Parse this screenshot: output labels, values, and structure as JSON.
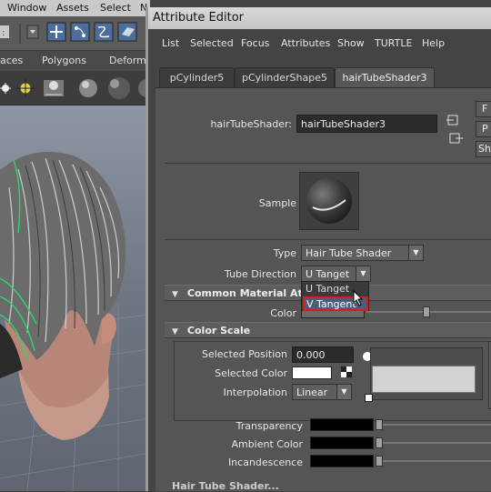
{
  "bg_menubar": [
    "Window",
    "Assets",
    "Select",
    "N"
  ],
  "bg_shelftabs": [
    "aces",
    "Polygons",
    "Deforma"
  ],
  "attribute_editor": {
    "title": "Attribute Editor",
    "menu": [
      "List",
      "Selected",
      "Focus",
      "Attributes",
      "Show",
      "TURTLE",
      "Help"
    ],
    "tabs": [
      "pCylinder5",
      "pCylinderShape5",
      "hairTubeShader3"
    ],
    "active_tab": "hairTubeShader3",
    "node_label": "hairTubeShader:",
    "node_name": "hairTubeShader3",
    "side_buttons": [
      "F",
      "P",
      "Sho"
    ],
    "sample_label": "Sample",
    "type_label": "Type",
    "type_value": "Hair Tube Shader",
    "tube_direction_label": "Tube Direction",
    "tube_direction_value": "U Tanget",
    "tube_direction_options": [
      "U Tanget",
      "V Tangent"
    ],
    "highlighted_option": "V Tangent",
    "section_common": "Common Material At",
    "color_label": "Color",
    "section_colorscale": "Color Scale",
    "selected_position_label": "Selected Position",
    "selected_position_value": "0.000",
    "selected_color_label": "Selected Color",
    "interpolation_label": "Interpolation",
    "interpolation_value": "Linear",
    "transparency_label": "Transparency",
    "ambient_label": "Ambient Color",
    "incandescence_label": "Incandescence",
    "bottom_section_partial": "Hair Tube Shader..."
  },
  "colors": {
    "highlight_box": "#e0191d",
    "hair_guides": "#2bd96b"
  }
}
